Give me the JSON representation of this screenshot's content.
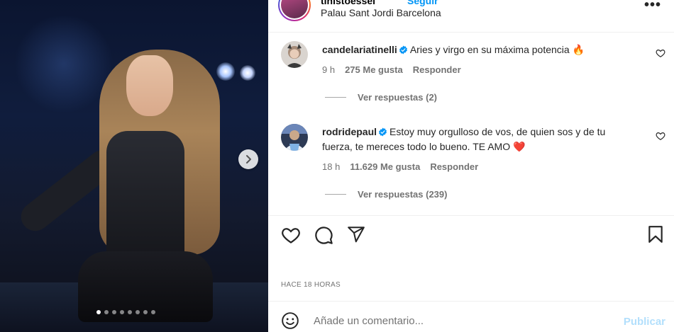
{
  "post": {
    "author": "tinistoessel",
    "follow_label": "Seguir",
    "location": "Palau Sant Jordi Barcelona",
    "more_label": "•••",
    "carousel": {
      "total_slides": 8,
      "current_slide": 1
    }
  },
  "comments": [
    {
      "username": "candelariatinelli",
      "verified": true,
      "text": "Aries y virgo en su máxima potencia 🔥",
      "time": "9 h",
      "likes": "275 Me gusta",
      "reply_label": "Responder",
      "view_replies": "Ver respuestas (2)"
    },
    {
      "username": "rodridepaul",
      "verified": true,
      "text": "Estoy muy orgulloso de vos, de quien sos y de tu fuerza, te mereces todo lo bueno. TE AMO ❤️",
      "time": "18 h",
      "likes": "11.629 Me gusta",
      "reply_label": "Responder",
      "view_replies": "Ver respuestas (239)"
    }
  ],
  "timestamp": "HACE 18 HORAS",
  "composer": {
    "placeholder": "Añade un comentario...",
    "publish_label": "Publicar"
  },
  "icons": {
    "like": "heart-icon",
    "comment": "comment-icon",
    "share": "share-icon",
    "save": "bookmark-icon",
    "emoji": "emoji-icon",
    "next": "chevron-right-icon"
  },
  "colors": {
    "link": "#0095f6",
    "verified": "#0095f6",
    "muted": "#737373",
    "publish_disabled": "#b2dffc"
  }
}
